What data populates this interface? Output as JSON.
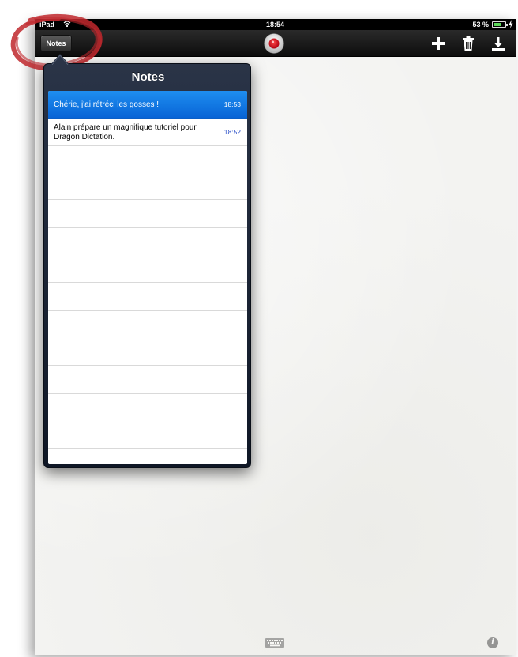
{
  "status_bar": {
    "carrier": "iPad",
    "time": "18:54",
    "battery": "53 %"
  },
  "toolbar": {
    "notes_label": "Notes",
    "icons": [
      "record-icon",
      "plus-icon",
      "trash-icon",
      "download-icon"
    ]
  },
  "popover": {
    "title": "Notes",
    "notes": [
      {
        "text": "Chérie, j'ai rétréci les gosses !",
        "time": "18:53",
        "selected": true
      },
      {
        "text": "Alain prépare un magnifique tutoriel pour Dragon Dictation.",
        "time": "18:52",
        "selected": false
      }
    ]
  },
  "bottom": {
    "icons": [
      "keyboard-icon",
      "info-icon"
    ],
    "info_glyph": "i"
  },
  "colors": {
    "selection_blue": "#0a6fe0",
    "time_blue": "#2a4fc8",
    "annotation_red": "#c0282d",
    "record_red": "#d6141e"
  }
}
